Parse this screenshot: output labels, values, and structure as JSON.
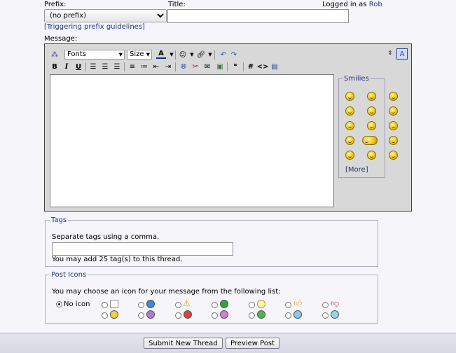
{
  "prefix": {
    "label": "Prefix:",
    "selected": "(no prefix)",
    "guidelines_link": "[Triggering prefix guidelines]"
  },
  "title": {
    "label": "Title:",
    "value": ""
  },
  "login": {
    "text": "Logged in as",
    "user": "Rob"
  },
  "message": {
    "label": "Message:"
  },
  "toolbar": {
    "fonts": "Fonts",
    "size": "Size"
  },
  "smilies": {
    "legend": "Smilies",
    "more": "[More]"
  },
  "tags": {
    "legend": "Tags",
    "hint": "Separate tags using a comma.",
    "value": "",
    "note": "You may add 25 tag(s) to this thread."
  },
  "post_icons": {
    "legend": "Post Icons",
    "hint": "You may choose an icon for your message from the following list:",
    "no_icon": "No icon"
  },
  "buttons": {
    "submit": "Submit New Thread",
    "preview": "Preview Post"
  },
  "colors": {
    "link": "#22357a",
    "legend": "#22357a"
  }
}
